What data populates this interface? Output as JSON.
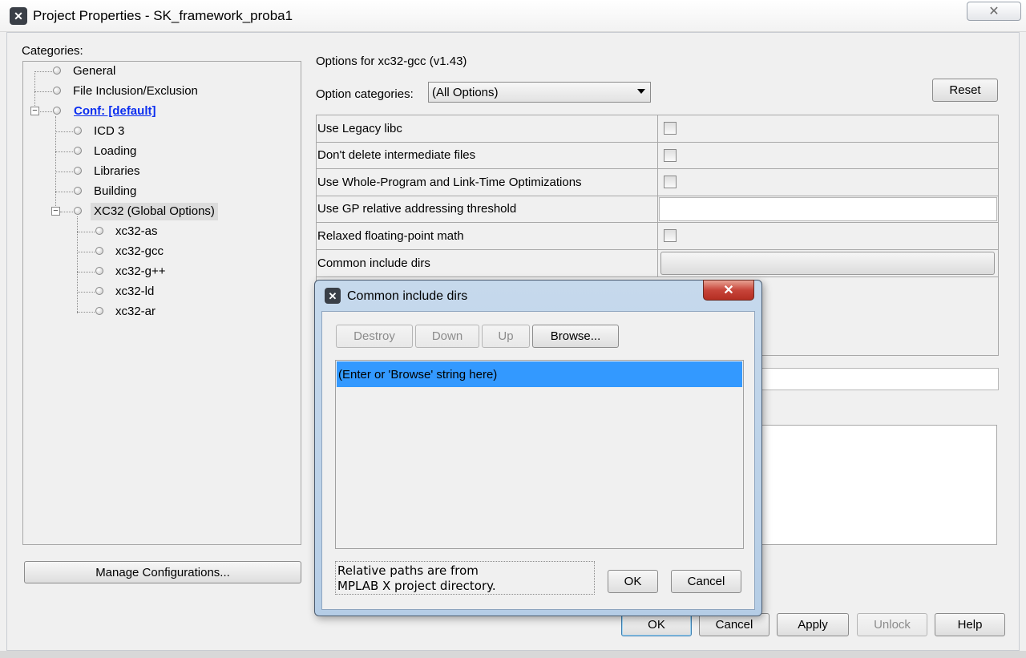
{
  "window": {
    "title": "Project Properties - SK_framework_proba1",
    "close_glyph": "✕"
  },
  "categories_label": "Categories:",
  "tree": [
    {
      "label": "General",
      "level": 1
    },
    {
      "label": "File Inclusion/Exclusion",
      "level": 1
    },
    {
      "label": "Conf: [default]",
      "level": 1,
      "link": true,
      "expanded": true
    },
    {
      "label": "ICD 3",
      "level": 2
    },
    {
      "label": "Loading",
      "level": 2
    },
    {
      "label": "Libraries",
      "level": 2
    },
    {
      "label": "Building",
      "level": 2
    },
    {
      "label": "XC32 (Global Options)",
      "level": 2,
      "selected": true,
      "expanded": true
    },
    {
      "label": "xc32-as",
      "level": 3
    },
    {
      "label": "xc32-gcc",
      "level": 3
    },
    {
      "label": "xc32-g++",
      "level": 3
    },
    {
      "label": "xc32-ld",
      "level": 3
    },
    {
      "label": "xc32-ar",
      "level": 3
    }
  ],
  "manage_configurations_label": "Manage Configurations...",
  "options_header": "Options for xc32-gcc (v1.43)",
  "option_categories": {
    "label": "Option categories:",
    "selected": "(All Options)"
  },
  "reset_label": "Reset",
  "properties": [
    {
      "name": "Use Legacy libc",
      "type": "checkbox",
      "checked": false
    },
    {
      "name": "Don't delete intermediate files",
      "type": "checkbox",
      "checked": false
    },
    {
      "name": "Use Whole-Program and Link-Time Optimizations",
      "type": "checkbox",
      "checked": false
    },
    {
      "name": "Use GP relative addressing threshold",
      "type": "text",
      "value": ""
    },
    {
      "name": "Relaxed floating-point math",
      "type": "checkbox",
      "checked": false
    },
    {
      "name": "Common include dirs",
      "type": "button"
    }
  ],
  "bottom_buttons": {
    "ok": "OK",
    "cancel": "Cancel",
    "apply": "Apply",
    "unlock": "Unlock",
    "help": "Help"
  },
  "dialog": {
    "title": "Common include dirs",
    "close_glyph": "✕",
    "toolbar": {
      "destroy": "Destroy",
      "down": "Down",
      "up": "Up",
      "browse": "Browse..."
    },
    "list_items": [
      "(Enter or 'Browse' string here)"
    ],
    "info_line1": "Relative paths are from",
    "info_line2": "MPLAB X project directory.",
    "ok": "OK",
    "cancel": "Cancel"
  },
  "colors": {
    "selection": "#3399ff",
    "link": "#0b2ef0",
    "dialog_frame": "#b5cde6",
    "close_red": "#c7453a"
  }
}
